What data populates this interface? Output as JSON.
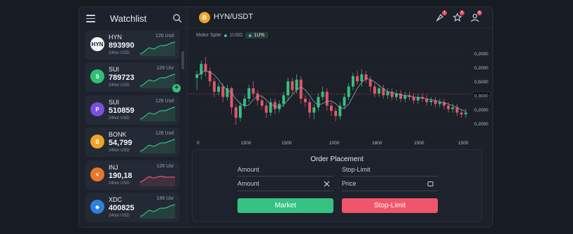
{
  "sidebar": {
    "title": "Watchlist",
    "items": [
      {
        "symbol": "HYN",
        "price": "893990",
        "sub": "24hor USD",
        "top": "126 Usd",
        "icon": "HYN",
        "icon_name": "hyn-coin-icon",
        "icon_bg": "#f4f6f8",
        "icon_fg": "#1b2029",
        "trend": "up"
      },
      {
        "symbol": "SUI",
        "price": "789723",
        "sub": "24hor USD",
        "top": "126 Usr",
        "icon": "S",
        "icon_name": "sui-coin-icon",
        "icon_bg": "#2fbf74",
        "icon_fg": "#ffffff",
        "trend": "up"
      },
      {
        "symbol": "SUI",
        "price": "510859",
        "sub": "24hor USD",
        "top": "126 Usd",
        "icon": "P",
        "icon_name": "sui-coin-icon",
        "icon_bg": "#7a4fe0",
        "icon_fg": "#ffffff",
        "trend": "up"
      },
      {
        "symbol": "BONK",
        "price": "54,799",
        "sub": "24hor USD",
        "top": "126 Usd",
        "icon": "B",
        "icon_name": "bonk-coin-icon",
        "icon_bg": "#f0a326",
        "icon_fg": "#ffffff",
        "trend": "up"
      },
      {
        "symbol": "INJ",
        "price": "190,18",
        "sub": "24hor USD",
        "top": "126 Usr",
        "icon": "✕",
        "icon_name": "inj-coin-icon",
        "icon_bg": "#e8772c",
        "icon_fg": "#ffffff",
        "trend": "down"
      },
      {
        "symbol": "XDC",
        "price": "400825",
        "sub": "24hor USD",
        "top": "146 Usr",
        "icon": "◆",
        "icon_name": "xdc-coin-icon",
        "icon_bg": "#2f7fe0",
        "icon_fg": "#ffffff",
        "trend": "up"
      }
    ]
  },
  "header": {
    "pair": "HYN/USDT",
    "pair_icon": "B",
    "notifications": [
      "1",
      "5",
      "8"
    ]
  },
  "legend": {
    "label": "Motor Spite",
    "item1": "1USD",
    "item2": "1U%"
  },
  "chart_data": {
    "type": "candlestick",
    "x_ticks": [
      "0",
      "1500",
      "1500",
      "1000",
      "1800",
      "1500",
      "1500"
    ],
    "y_ticks": [
      "0,2000",
      "0,2000",
      "0,5000",
      "0,3000",
      "0,2000",
      "0,2000"
    ],
    "highlighted_tick": "0,3000",
    "colors": {
      "up": "#35c07e",
      "down": "#e4556a",
      "ma": "#8fa7b8"
    },
    "candles": [
      [
        0.62,
        0.66,
        0.48,
        0.7
      ],
      [
        0.66,
        0.78,
        0.6,
        0.82
      ],
      [
        0.78,
        0.7,
        0.64,
        0.86
      ],
      [
        0.7,
        0.58,
        0.52,
        0.74
      ],
      [
        0.58,
        0.46,
        0.4,
        0.62
      ],
      [
        0.46,
        0.52,
        0.42,
        0.56
      ],
      [
        0.52,
        0.4,
        0.34,
        0.56
      ],
      [
        0.4,
        0.5,
        0.36,
        0.54
      ],
      [
        0.5,
        0.28,
        0.2,
        0.52
      ],
      [
        0.28,
        0.16,
        0.08,
        0.32
      ],
      [
        0.16,
        0.3,
        0.12,
        0.34
      ],
      [
        0.3,
        0.38,
        0.26,
        0.42
      ],
      [
        0.38,
        0.5,
        0.34,
        0.54
      ],
      [
        0.5,
        0.44,
        0.4,
        0.58
      ],
      [
        0.44,
        0.36,
        0.3,
        0.48
      ],
      [
        0.36,
        0.3,
        0.26,
        0.4
      ],
      [
        0.3,
        0.22,
        0.16,
        0.34
      ],
      [
        0.22,
        0.34,
        0.18,
        0.38
      ],
      [
        0.34,
        0.26,
        0.2,
        0.38
      ],
      [
        0.26,
        0.32,
        0.22,
        0.36
      ],
      [
        0.32,
        0.42,
        0.28,
        0.46
      ],
      [
        0.42,
        0.58,
        0.36,
        0.62
      ],
      [
        0.58,
        0.48,
        0.44,
        0.62
      ],
      [
        0.48,
        0.6,
        0.44,
        0.66
      ],
      [
        0.6,
        0.38,
        0.32,
        0.64
      ],
      [
        0.38,
        0.34,
        0.28,
        0.42
      ],
      [
        0.34,
        0.22,
        0.16,
        0.38
      ],
      [
        0.22,
        0.28,
        0.14,
        0.32
      ],
      [
        0.28,
        0.4,
        0.24,
        0.44
      ],
      [
        0.4,
        0.46,
        0.36,
        0.52
      ],
      [
        0.46,
        0.3,
        0.24,
        0.5
      ],
      [
        0.3,
        0.24,
        0.18,
        0.34
      ],
      [
        0.24,
        0.18,
        0.12,
        0.28
      ],
      [
        0.18,
        0.3,
        0.14,
        0.34
      ],
      [
        0.3,
        0.4,
        0.26,
        0.44
      ],
      [
        0.4,
        0.52,
        0.36,
        0.56
      ],
      [
        0.52,
        0.64,
        0.48,
        0.68
      ],
      [
        0.64,
        0.58,
        0.54,
        0.7
      ],
      [
        0.58,
        0.66,
        0.52,
        0.72
      ],
      [
        0.66,
        0.6,
        0.56,
        0.7
      ],
      [
        0.6,
        0.52,
        0.46,
        0.64
      ],
      [
        0.52,
        0.44,
        0.4,
        0.56
      ],
      [
        0.44,
        0.5,
        0.4,
        0.54
      ],
      [
        0.5,
        0.42,
        0.38,
        0.54
      ],
      [
        0.42,
        0.46,
        0.38,
        0.5
      ],
      [
        0.46,
        0.4,
        0.36,
        0.5
      ],
      [
        0.4,
        0.44,
        0.36,
        0.48
      ],
      [
        0.44,
        0.38,
        0.34,
        0.48
      ],
      [
        0.38,
        0.42,
        0.34,
        0.46
      ],
      [
        0.42,
        0.4,
        0.36,
        0.46
      ],
      [
        0.4,
        0.36,
        0.32,
        0.44
      ],
      [
        0.36,
        0.4,
        0.32,
        0.44
      ],
      [
        0.4,
        0.38,
        0.34,
        0.44
      ],
      [
        0.38,
        0.34,
        0.3,
        0.42
      ],
      [
        0.34,
        0.36,
        0.3,
        0.4
      ],
      [
        0.36,
        0.32,
        0.28,
        0.4
      ],
      [
        0.32,
        0.34,
        0.28,
        0.38
      ],
      [
        0.34,
        0.3,
        0.26,
        0.38
      ],
      [
        0.3,
        0.26,
        0.22,
        0.34
      ],
      [
        0.26,
        0.28,
        0.22,
        0.32
      ],
      [
        0.28,
        0.22,
        0.18,
        0.32
      ],
      [
        0.22,
        0.2,
        0.16,
        0.26
      ],
      [
        0.2,
        0.22,
        0.16,
        0.26
      ]
    ]
  },
  "order": {
    "title": "Order Placement",
    "label_left": "Amount",
    "label_right": "Stop-Limit",
    "input_left": "Amount",
    "input_right": "Price",
    "btn_market": "Market",
    "btn_stop": "Stop-Limit"
  }
}
